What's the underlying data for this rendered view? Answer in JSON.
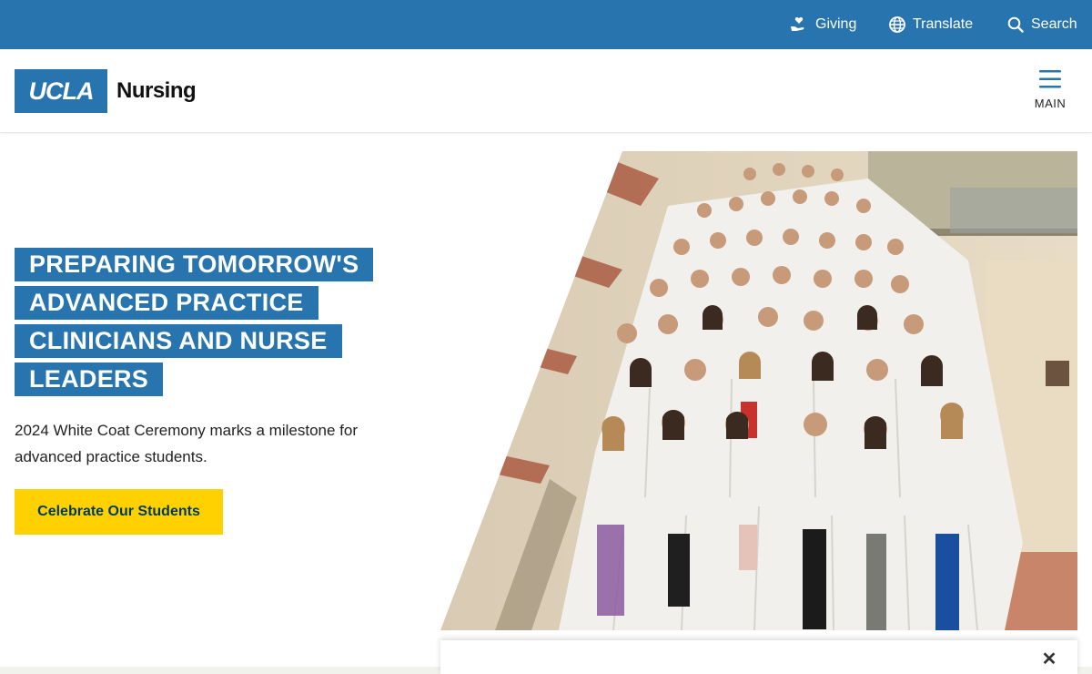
{
  "utility_nav": {
    "giving": {
      "label": "Giving",
      "icon": "hand-heart-icon"
    },
    "translate": {
      "label": "Translate",
      "icon": "globe-icon"
    },
    "search": {
      "label": "Search",
      "icon": "search-icon"
    }
  },
  "header": {
    "logo_mark": "UCLA",
    "logo_text": "Nursing",
    "menu_label": "MAIN"
  },
  "hero": {
    "title_lines": [
      "PREPARING TOMORROW'S",
      "ADVANCED PRACTICE",
      "CLINICIANS AND NURSE",
      "LEADERS"
    ],
    "description": "2024 White Coat Ceremony marks a milestone for advanced practice students.",
    "cta_label": "Celebrate Our Students"
  },
  "popup": {
    "close_symbol": "✕"
  },
  "colors": {
    "brand_blue": "#2774ae",
    "cta_yellow": "#ffd100",
    "cta_text": "#003b5c"
  }
}
